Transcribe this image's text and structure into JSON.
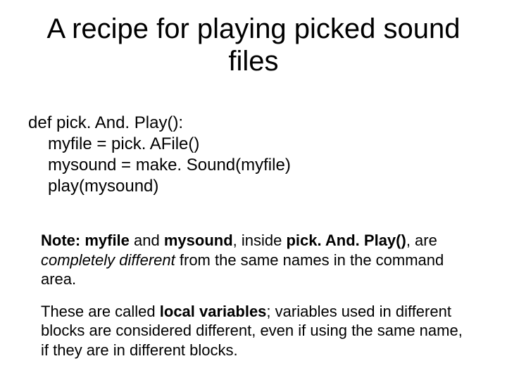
{
  "title": "A recipe for playing picked sound files",
  "code": {
    "l1": "def pick. And. Play():",
    "l2": "myfile = pick. AFile()",
    "l3": "mysound = make. Sound(myfile)",
    "l4": "play(mysound)"
  },
  "note1": {
    "t1": "Note: myfile",
    "t2": " and ",
    "t3": "mysound",
    "t4": ", inside ",
    "t5": "pick. And. Play()",
    "t6": ", are ",
    "t7": "completely different",
    "t8": " from the same names in the command area."
  },
  "note2": {
    "t1": "These are called ",
    "t2": "local variables",
    "t3": ";  variables used in different blocks are considered different, even if using the same name, if they are in different blocks."
  }
}
